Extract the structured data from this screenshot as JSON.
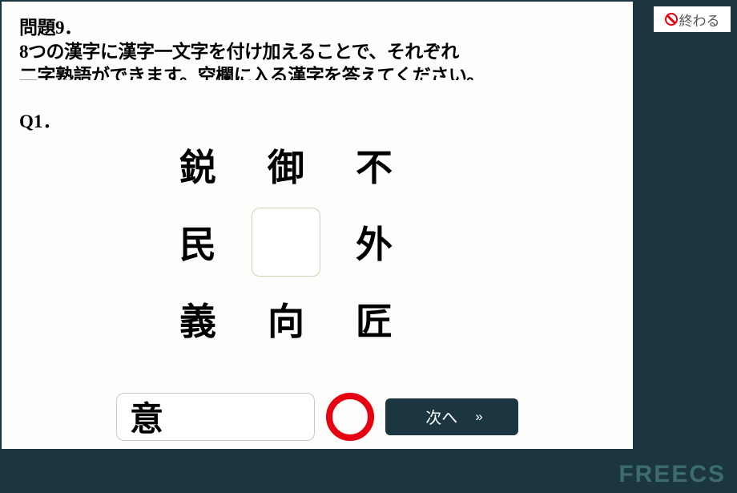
{
  "header": {
    "problem_label": "問題9．",
    "line1": "8つの漢字に漢字一文字を付け加えることで、それぞれ",
    "line2": "二字熟語ができます。空欄に入る漢字を答えてください。"
  },
  "question": {
    "label": "Q1．",
    "grid": {
      "top_left": "鋭",
      "top_center": "御",
      "top_right": "不",
      "mid_left": "民",
      "mid_right": "外",
      "bottom_left": "義",
      "bottom_center": "向",
      "bottom_right": "匠"
    }
  },
  "answer": {
    "value": "意"
  },
  "buttons": {
    "next": "次へ",
    "end": "終わる"
  },
  "brand": "FREECS"
}
